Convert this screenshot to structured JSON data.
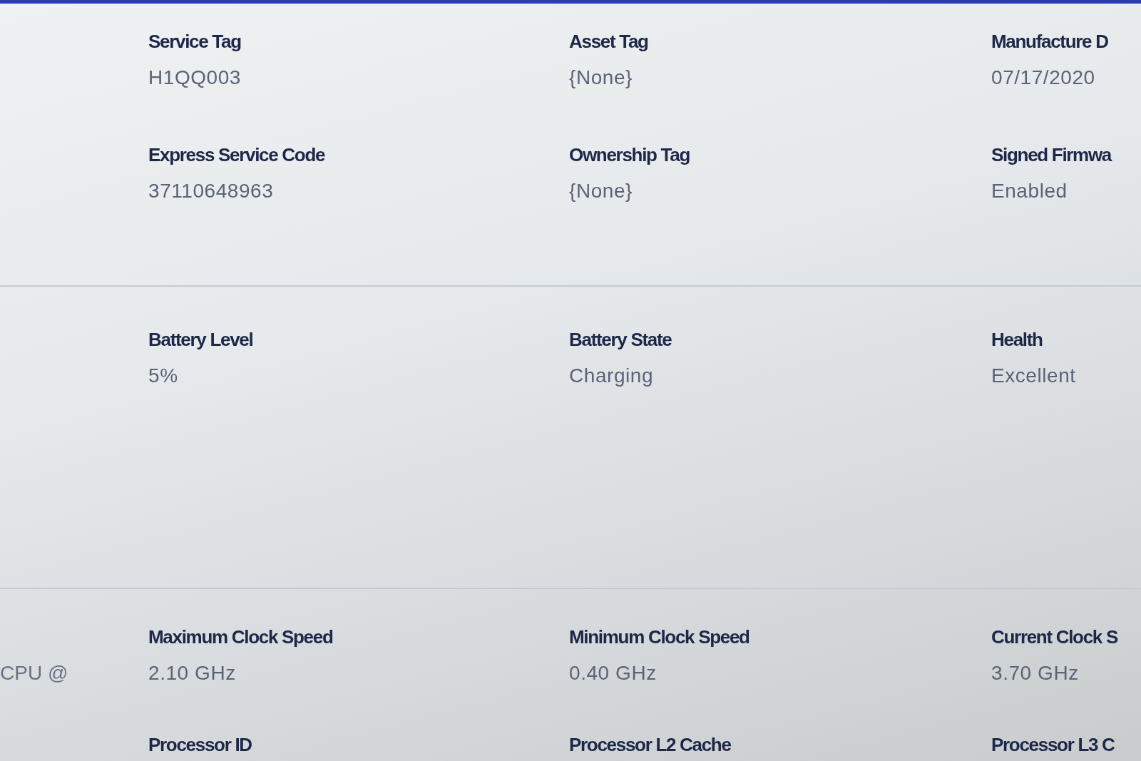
{
  "sections": [
    {
      "rows": [
        [
          {
            "label": "Service Tag",
            "value": "H1QQ003"
          },
          {
            "label": "Asset Tag",
            "value": "{None}"
          },
          {
            "label": "Manufacture D",
            "value": "07/17/2020"
          }
        ],
        [
          {
            "label": "Express Service Code",
            "value": "37110648963"
          },
          {
            "label": "Ownership Tag",
            "value": "{None}"
          },
          {
            "label": "Signed Firmwa",
            "value": "Enabled"
          }
        ]
      ]
    },
    {
      "rows": [
        [
          {
            "label": "Battery Level",
            "value": "5%"
          },
          {
            "label": "Battery State",
            "value": "Charging"
          },
          {
            "label": "Health",
            "value": "Excellent"
          }
        ]
      ]
    },
    {
      "side_text": "CPU @",
      "rows": [
        [
          {
            "label": "Maximum Clock Speed",
            "value": "2.10 GHz"
          },
          {
            "label": "Minimum Clock Speed",
            "value": "0.40 GHz"
          },
          {
            "label": "Current Clock S",
            "value": "3.70 GHz"
          }
        ],
        [
          {
            "label": "Processor ID"
          },
          {
            "label": "Processor L2 Cache"
          },
          {
            "label": "Processor L3 C"
          }
        ]
      ]
    }
  ]
}
